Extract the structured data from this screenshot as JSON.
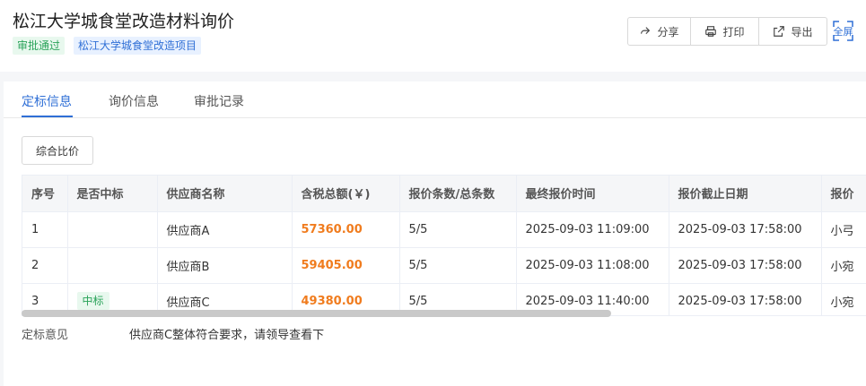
{
  "header": {
    "title": "松江大学城食堂改造材料询价",
    "tags": [
      "审批通过",
      "松江大学城食堂改造项目"
    ],
    "actions": {
      "share": "分享",
      "print": "打印",
      "export": "导出"
    },
    "fullscreen": "全屏"
  },
  "tabs": [
    {
      "label": "定标信息",
      "active": true
    },
    {
      "label": "询价信息",
      "active": false
    },
    {
      "label": "审批记录",
      "active": false
    }
  ],
  "compare_button": "综合比价",
  "table": {
    "columns": [
      "序号",
      "是否中标",
      "供应商名称",
      "含税总额(￥)",
      "报价条数/总条数",
      "最终报价时间",
      "报价截止日期",
      "报价"
    ],
    "rows": [
      {
        "index": "1",
        "winner": "",
        "supplier": "供应商A",
        "total": "57360.00",
        "count": "5/5",
        "final_time": "2025-09-03 11:09:00",
        "deadline": "2025-09-03 17:58:00",
        "extra": "小弓"
      },
      {
        "index": "2",
        "winner": "",
        "supplier": "供应商B",
        "total": "59405.00",
        "count": "5/5",
        "final_time": "2025-09-03 11:08:00",
        "deadline": "2025-09-03 17:58:00",
        "extra": "小宛"
      },
      {
        "index": "3",
        "winner": "中标",
        "supplier": "供应商C",
        "total": "49380.00",
        "count": "5/5",
        "final_time": "2025-09-03 11:40:00",
        "deadline": "2025-09-03 17:58:00",
        "extra": "小宛"
      }
    ]
  },
  "opinion": {
    "label": "定标意见",
    "value": "供应商C整体符合要求，请领导查看下"
  },
  "colors": {
    "primary": "#2f6fd6",
    "success": "#2aa35a",
    "price": "#f07c1e"
  }
}
